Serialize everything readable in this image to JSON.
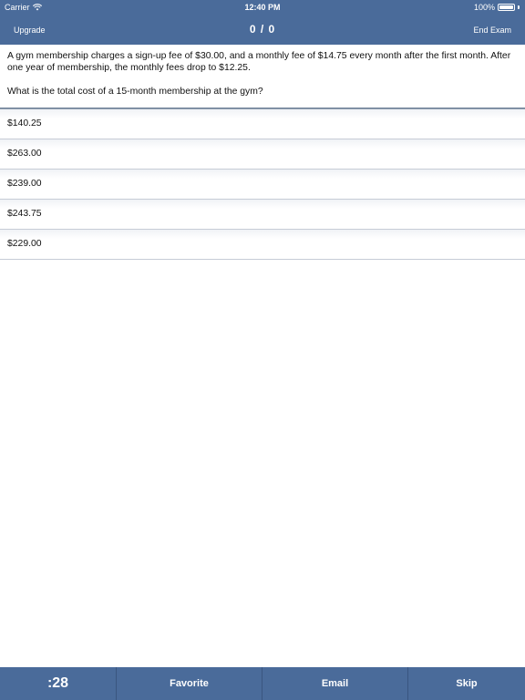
{
  "status_bar": {
    "carrier": "Carrier",
    "time": "12:40 PM",
    "battery": "100%",
    "battery_level": 1.0,
    "wifi_icon": "wifi-icon",
    "battery_icon": "battery-icon"
  },
  "nav": {
    "left_label": "Upgrade",
    "title": "0 / 0",
    "right_label": "End Exam"
  },
  "question": {
    "text": "A gym membership charges a sign-up fee of $30.00, and a monthly fee of $14.75 every month after the first month. After one year of membership, the monthly fees drop to $12.25.",
    "prompt": "What is the total cost of a 15-month membership at the gym?"
  },
  "answers": [
    {
      "label": "$140.25"
    },
    {
      "label": "$263.00"
    },
    {
      "label": "$239.00"
    },
    {
      "label": "$243.75"
    },
    {
      "label": "$229.00"
    }
  ],
  "toolbar": {
    "timer": ":28",
    "favorite": "Favorite",
    "email": "Email",
    "skip": "Skip"
  },
  "colors": {
    "bar": "#4a6b9a",
    "divider": "#c6ccd6",
    "text": "#111111"
  }
}
